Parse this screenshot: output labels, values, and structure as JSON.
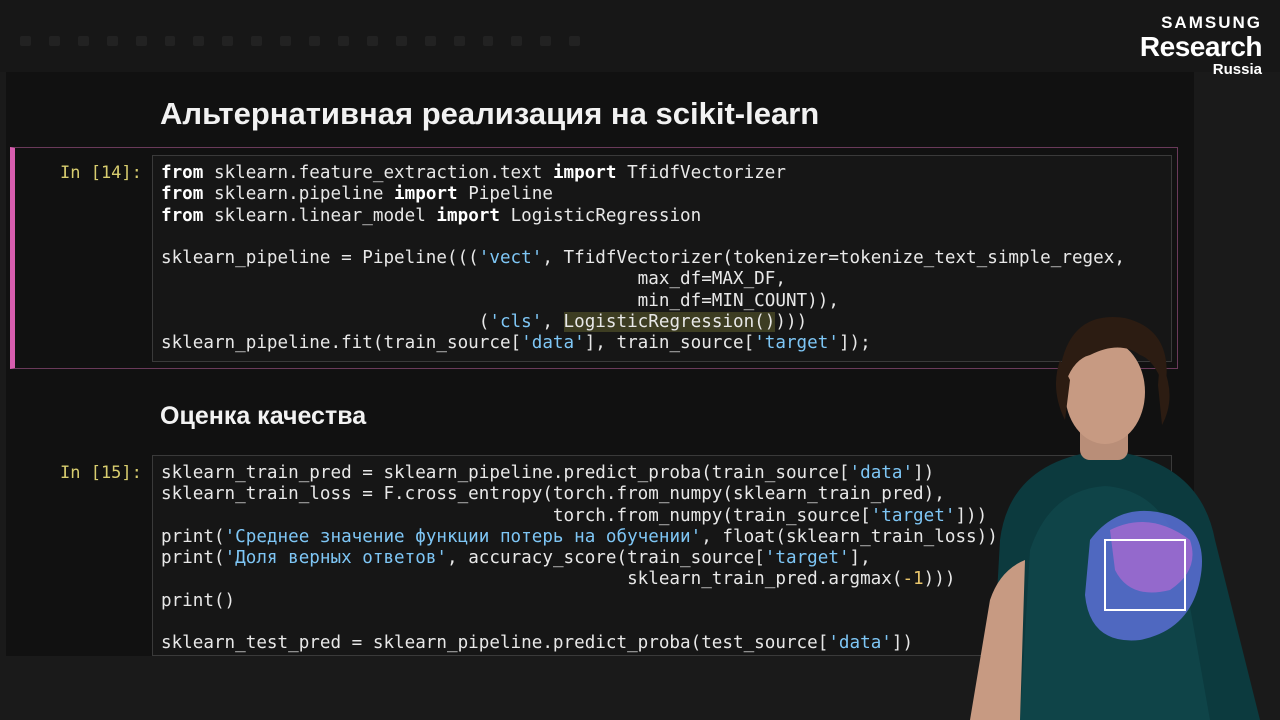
{
  "branding": {
    "line1": "SAMSUNG",
    "line2": "Research",
    "line3": "Russia"
  },
  "notebook": {
    "heading1": "Альтернативная реализация на scikit-learn",
    "heading2": "Оценка качества",
    "cell14": {
      "prompt": "In [14]:"
    },
    "cell15": {
      "prompt": "In [15]:"
    }
  },
  "code14": {
    "t1": "from",
    "t2": " sklearn.feature_extraction.text ",
    "t3": "import",
    "t4": " TfidfVectorizer",
    "t5": "from",
    "t6": " sklearn.pipeline ",
    "t7": "import",
    "t8": " Pipeline",
    "t9": "from",
    "t10": " sklearn.linear_model ",
    "t11": "import",
    "t12": " LogisticRegression",
    "t13": "sklearn_pipeline = Pipeline(((",
    "t14": "'vect'",
    "t15": ", TfidfVectorizer(tokenizer=tokenize_text_simple_regex,",
    "t16": "                                             max_df=MAX_DF,",
    "t17": "                                             min_df=MIN_COUNT)),",
    "t18": "                              (",
    "t19": "'cls'",
    "t20": ", ",
    "t21": "LogisticRegression()",
    "t22": ")))",
    "t23": "sklearn_pipeline.fit(train_source[",
    "t24": "'data'",
    "t25": "], train_source[",
    "t26": "'target'",
    "t27": "]);"
  },
  "code15": {
    "t1": "sklearn_train_pred = sklearn_pipeline.predict_proba(train_source[",
    "t2": "'data'",
    "t3": "])",
    "t4": "sklearn_train_loss = F.cross_entropy(torch.from_numpy(sklearn_train_pred),",
    "t5": "                                     torch.from_numpy(train_source[",
    "t6": "'target'",
    "t7": "]))",
    "t8": "print",
    "t9": "(",
    "t10": "'Среднее значение функции потерь на обучении'",
    "t11": ", ",
    "t12": "float",
    "t13": "(sklearn_train_loss))",
    "t14": "print",
    "t15": "(",
    "t16": "'Доля верных ответов'",
    "t17": ", accuracy_score(train_source[",
    "t18": "'target'",
    "t19": "],",
    "t20": "                                            sklearn_train_pred.argmax(",
    "t21": "-1",
    "t22": ")))",
    "t23": "print",
    "t24": "()",
    "t25": "sklearn_test_pred = sklearn_pipeline.predict_proba(test_source[",
    "t26": "'data'",
    "t27": "])"
  },
  "colors": {
    "keyword": "#ffffff",
    "string": "#7ec6f5",
    "number": "#e8c56c",
    "prompt": "#d8cd6f",
    "selected_cell_border": "#d75dae"
  }
}
